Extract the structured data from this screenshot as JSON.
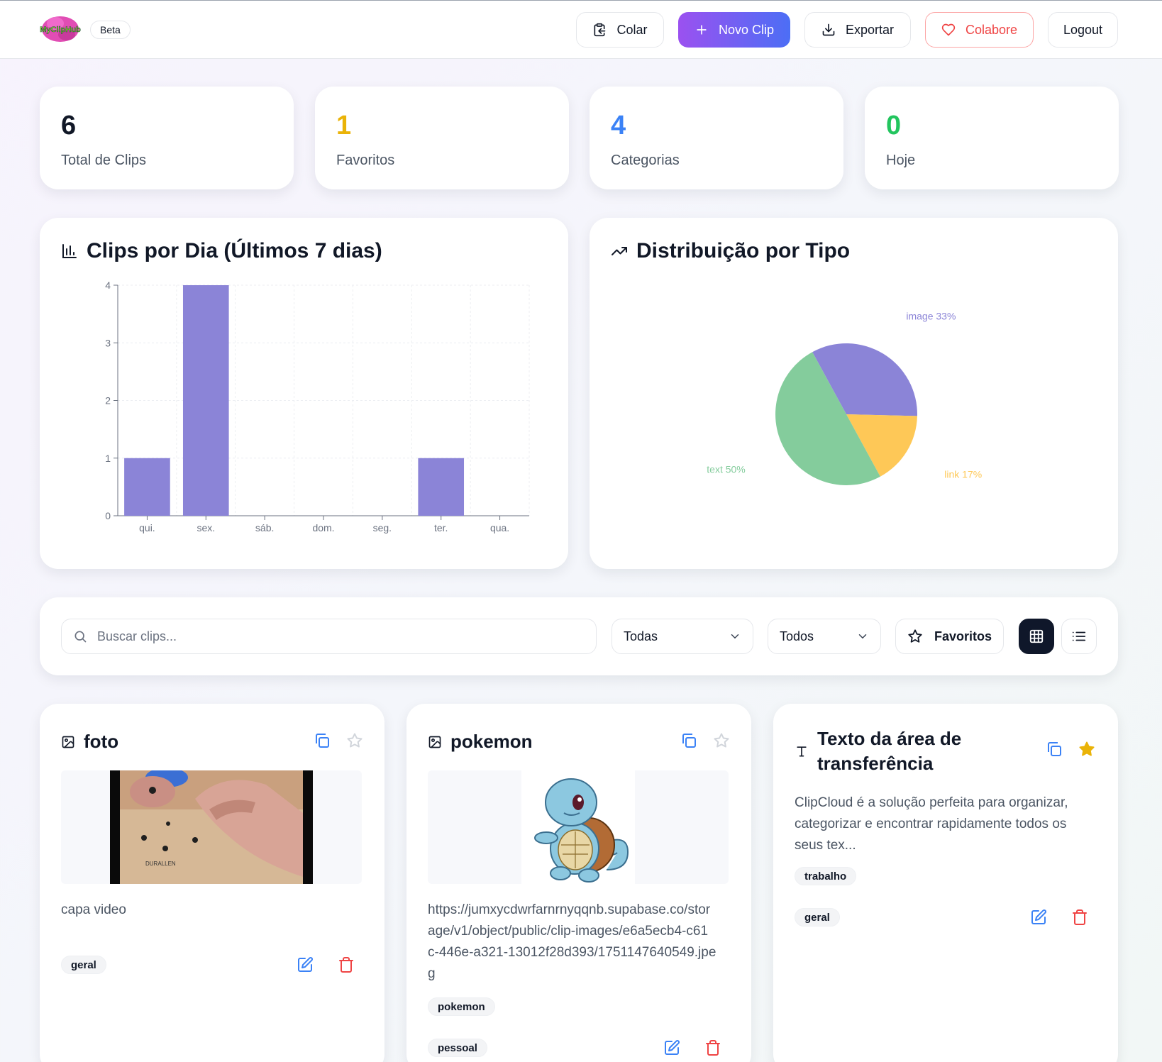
{
  "header": {
    "logo_text": "MyClipHub",
    "beta_label": "Beta",
    "buttons": {
      "colar": "Colar",
      "novo_clip": "Novo Clip",
      "exportar": "Exportar",
      "colabore": "Colabore",
      "logout": "Logout"
    }
  },
  "stats": [
    {
      "value": "6",
      "label": "Total de Clips",
      "color": "#111827"
    },
    {
      "value": "1",
      "label": "Favoritos",
      "color": "#eab308"
    },
    {
      "value": "4",
      "label": "Categorias",
      "color": "#3b82f6"
    },
    {
      "value": "0",
      "label": "Hoje",
      "color": "#22c55e"
    }
  ],
  "charts": {
    "bar_title": "Clips por Dia (Últimos 7 dias)",
    "pie_title": "Distribuição por Tipo"
  },
  "chart_data": [
    {
      "type": "bar",
      "title": "Clips por Dia (Últimos 7 dias)",
      "categories": [
        "qui.",
        "sex.",
        "sáb.",
        "dom.",
        "seg.",
        "ter.",
        "qua."
      ],
      "values": [
        1,
        4,
        0,
        0,
        0,
        1,
        0
      ],
      "ylim": [
        0,
        4
      ],
      "yticks": [
        "0",
        "1",
        "2",
        "3",
        "4"
      ],
      "grid": true,
      "color": "#8b84d7"
    },
    {
      "type": "pie",
      "title": "Distribuição por Tipo",
      "slices": [
        {
          "label": "image 33%",
          "value": 33.33,
          "color": "#8b84d7"
        },
        {
          "label": "link 17%",
          "value": 16.67,
          "color": "#fec857"
        },
        {
          "label": "text 50%",
          "value": 50,
          "color": "#84cc9c"
        }
      ]
    }
  ],
  "filters": {
    "search_placeholder": "Buscar clips...",
    "category_value": "Todas",
    "type_value": "Todos",
    "favorites_label": "Favoritos"
  },
  "clips": [
    {
      "title": "foto",
      "kind_icon": "image-icon",
      "description": "capa video",
      "tag": "geral",
      "favorite": false
    },
    {
      "title": "pokemon",
      "kind_icon": "image-icon",
      "url_lines": [
        "https://jumxycdwrfarnrnyqqnb.supabase.co/stor",
        "age/v1/object/public/clip-images/e6a5ecb4-c61",
        "c-446e-a321-13012f28d393/1751147640549.jpe",
        "g"
      ],
      "category": "pokemon",
      "tag": "pessoal",
      "favorite": false
    },
    {
      "title_lines": [
        "Texto da área de",
        "transferência"
      ],
      "kind_icon": "text-icon",
      "text_lines": [
        "ClipCloud é a solução perfeita para organizar,",
        "categorizar e encontrar rapidamente todos os",
        "seus tex..."
      ],
      "category": "trabalho",
      "tag": "geral",
      "favorite": true
    }
  ]
}
